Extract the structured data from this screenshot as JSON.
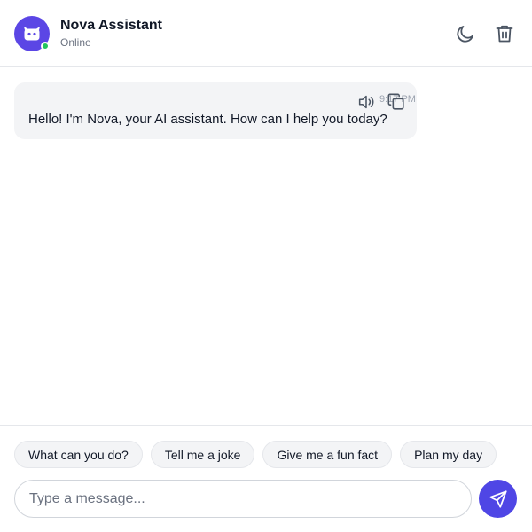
{
  "header": {
    "title": "Nova Assistant",
    "status": "Online",
    "avatar_icon": "robot-icon",
    "actions": [
      {
        "name": "dark-mode-toggle",
        "icon": "moon-icon"
      },
      {
        "name": "clear-chat-button",
        "icon": "trash-icon"
      }
    ]
  },
  "messages": [
    {
      "sender": "assistant",
      "text": "Hello! I'm Nova, your AI assistant. How can I help you today?",
      "time": "9:17 PM",
      "tools": [
        "speaker-icon",
        "copy-icon"
      ]
    }
  ],
  "suggestions": [
    "What can you do?",
    "Tell me a joke",
    "Give me a fun fact",
    "Plan my day"
  ],
  "composer": {
    "placeholder": "Type a message...",
    "value": "",
    "send_icon": "send-icon"
  },
  "colors": {
    "accent": "#4f46e5",
    "avatar_bg": "#5b46e5",
    "online": "#22c55e",
    "bubble_bg": "#f3f4f6",
    "border": "#e5e7eb"
  }
}
